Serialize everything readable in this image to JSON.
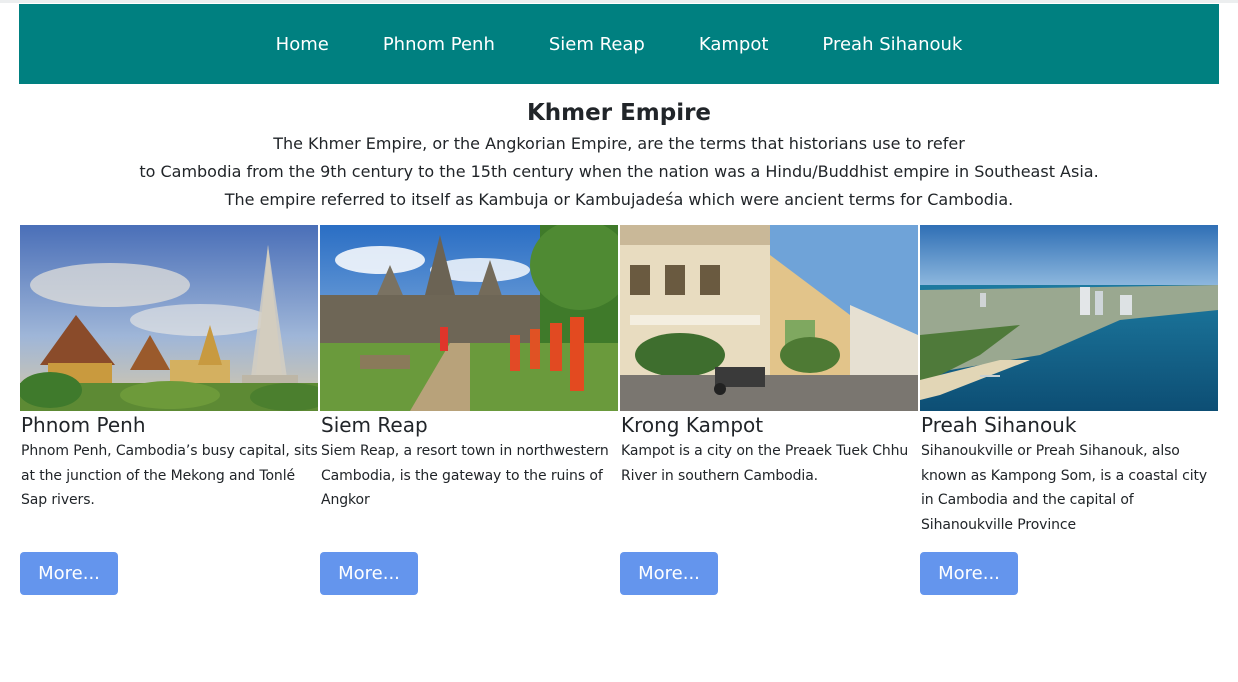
{
  "nav": {
    "items": [
      {
        "label": "Home"
      },
      {
        "label": "Phnom Penh"
      },
      {
        "label": "Siem Reap"
      },
      {
        "label": "Kampot"
      },
      {
        "label": "Preah Sihanouk"
      }
    ]
  },
  "intro": {
    "title": "Khmer Empire",
    "lines": [
      "The Khmer Empire, or the Angkorian Empire, are the terms that historians use to refer",
      "to Cambodia from the 9th century to the 15th century when the nation was a Hindu/Buddhist empire in Southeast Asia.",
      "The empire referred to itself as Kambuja or Kambujadeśa which were ancient terms for Cambodia."
    ]
  },
  "cards": [
    {
      "title": "Phnom Penh",
      "text": "Phnom Penh, Cambodia’s busy capital, sits at the junction of the Mekong and Tonlé Sap rivers.",
      "button": "More..."
    },
    {
      "title": "Siem Reap",
      "text": "Siem Reap, a resort town in northwestern Cambodia, is the gateway to the ruins of Angkor",
      "button": "More..."
    },
    {
      "title": "Krong Kampot",
      "text": "Kampot is a city on the Preaek Tuek Chhu River in southern Cambodia.",
      "button": "More..."
    },
    {
      "title": "Preah Sihanouk",
      "text": "Sihanoukville or Preah Sihanouk, also known as Kampong Som, is a coastal city in Cambodia and the capital of Sihanoukville Province",
      "button": "More..."
    }
  ],
  "colors": {
    "navbar": "#008080",
    "button": "#6495ed",
    "text": "#212529"
  }
}
